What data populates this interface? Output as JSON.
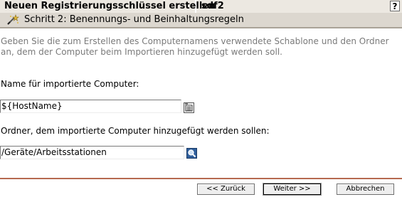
{
  "window": {
    "title": "Neuen Registrierungsschlüssel erstellen",
    "subtitle": "sdf2",
    "help_label": "?"
  },
  "step": {
    "title": "Schritt 2: Benennungs- und Beinhaltungsregeln",
    "icon": "wizard-wand-icon"
  },
  "intro_text": "Geben Sie die zum Erstellen des Computernamens verwendete Schablone und den Ordner an, dem der Computer beim Importieren hinzugefügt werden soll.",
  "name_field": {
    "label": "Name für importierte Computer:",
    "value": "${HostName}",
    "icon": "variable-list-icon"
  },
  "folder_field": {
    "label": "Ordner, dem importierte Computer hinzugefügt werden sollen:",
    "value": "/Geräte/Arbeitsstationen",
    "icon": "browse-search-icon"
  },
  "buttons": {
    "back": "<< Zurück",
    "next": "Weiter >>",
    "cancel": "Abbrechen"
  },
  "colors": {
    "accent_line": "#b66a50",
    "title_bg": "#ece8e1",
    "step_bg": "#dcd7cf"
  }
}
